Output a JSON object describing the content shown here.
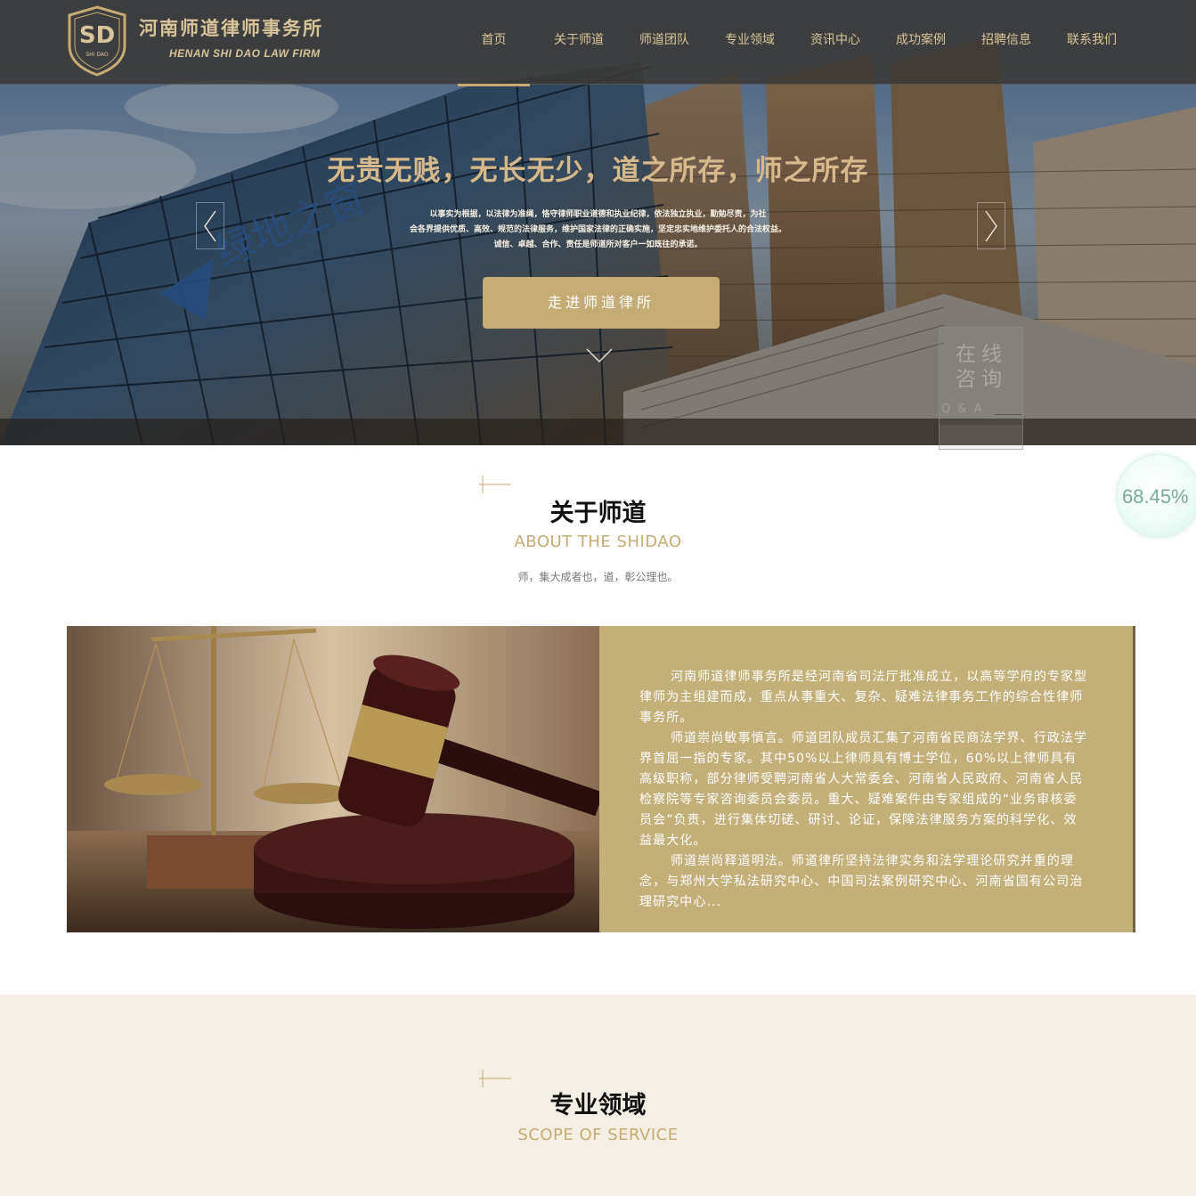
{
  "header": {
    "logo_mark": "SD",
    "logo_sub": "SHI DAO",
    "logo_cn": "河南师道律师事务所",
    "logo_en": "HENAN SHI DAO LAW FIRM",
    "nav": [
      {
        "label": "首页",
        "active": true
      },
      {
        "label": "关于师道"
      },
      {
        "label": "师道团队"
      },
      {
        "label": "专业领域"
      },
      {
        "label": "资讯中心"
      },
      {
        "label": "成功案例"
      },
      {
        "label": "招聘信息"
      },
      {
        "label": "联系我们"
      }
    ]
  },
  "hero": {
    "building_sign": "绿地之窗",
    "title": "无贵无贱，无长无少，道之所存，师之所存",
    "desc_lines": [
      "以事实为根据，以法律为准绳，恪守律师职业道德和执业纪律，依法独立执业，勤勉尽责，为社",
      "会各界提供优质、高效、规范的法律服务，维护国家法律的正确实施，坚定忠实地维护委托人的合法权益。",
      "诚信、卓越、合作、责任是师道所对客户一如既往的承诺。"
    ],
    "button": "走进师道律所"
  },
  "consult": {
    "cn": "在线咨询",
    "en": "Q & A"
  },
  "progress": {
    "text": "68.45%",
    "value": 68.45
  },
  "about": {
    "title": "关于师道",
    "en": "ABOUT THE SHIDAO",
    "motto": "师，集大成者也，道，彰公理也。",
    "paragraphs": [
      "河南师道律师事务所是经河南省司法厅批准成立，以高等学府的专家型律师为主组建而成，重点从事重大、复杂、疑难法律事务工作的综合性律师事务所。",
      "师道崇尚敏事慎言。师道团队成员汇集了河南省民商法学界、行政法学界首屈一指的专家。其中50%以上律师具有博士学位，60%以上律师具有高级职称，部分律师受聘河南省人大常委会、河南省人民政府、河南省人民检察院等专家咨询委员会委员。重大、疑难案件由专家组成的“业务审核委员会”负责，进行集体切磋、研讨、论证，保障法律服务方案的科学化、效益最大化。",
      "师道崇尚释道明法。师道律所坚持法律实务和法学理论研究并重的理念，与郑州大学私法研究中心、中国司法案例研究中心、河南省国有公司治理研究中心..."
    ]
  },
  "service": {
    "title": "专业领域",
    "en": "SCOPE OF SERVICE"
  },
  "colors": {
    "gold": "#c5ab74",
    "header_bg": "#3a3834",
    "about_panel": "#c3b078",
    "service_bg": "#f4efe4"
  },
  "icons": [
    "logo-shield-icon",
    "arrow-left-icon",
    "arrow-right-icon",
    "chevron-down-icon",
    "section-mark-icon"
  ]
}
